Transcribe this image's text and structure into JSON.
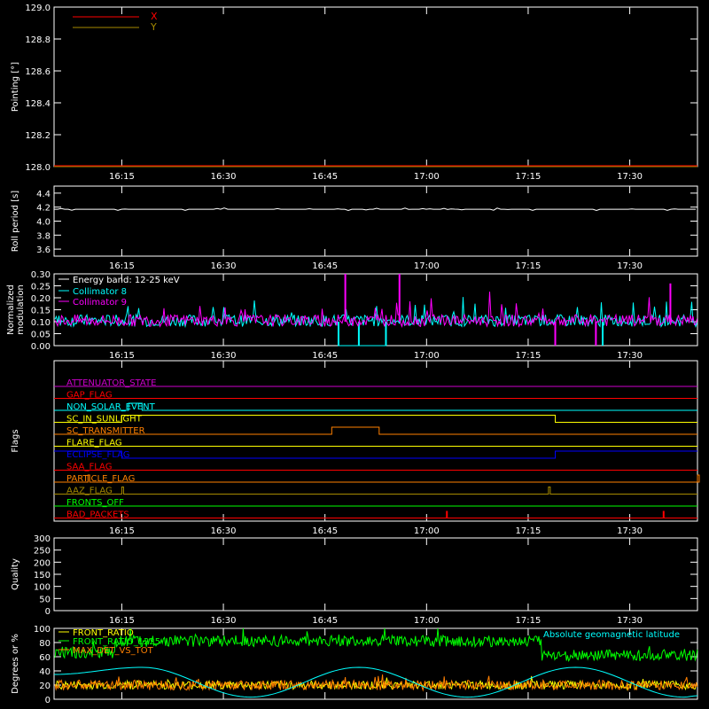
{
  "chart_data": [
    {
      "type": "line",
      "panel": "pointing",
      "ylabel": "Pointing [°]",
      "xlim": [
        "16:05",
        "17:40"
      ],
      "x_ticks": [
        "16:15",
        "16:30",
        "16:45",
        "17:00",
        "17:15",
        "17:30"
      ],
      "ylim": [
        128.0,
        129.0
      ],
      "y_ticks": [
        "128.0",
        "128.2",
        "128.4",
        "128.6",
        "128.8",
        "129.0"
      ],
      "legend": "top-left",
      "series": [
        {
          "name": "X",
          "color": "#ff0000",
          "x": [
            "16:05",
            "17:40"
          ],
          "y": [
            128.0,
            128.0
          ]
        },
        {
          "name": "Y",
          "color": "#a68a00",
          "x": [
            "16:05",
            "17:40"
          ],
          "y": [
            128.0,
            128.0
          ]
        }
      ]
    },
    {
      "type": "line",
      "panel": "roll",
      "ylabel": "Roll period [s]",
      "xlim": [
        "16:05",
        "17:40"
      ],
      "x_ticks": [
        "16:15",
        "16:30",
        "16:45",
        "17:00",
        "17:15",
        "17:30"
      ],
      "ylim": [
        3.5,
        4.5
      ],
      "y_ticks": [
        "3.6",
        "3.8",
        "4.0",
        "4.2",
        "4.4"
      ],
      "series": [
        {
          "color": "#ffffff",
          "x": [
            "16:05",
            "17:40"
          ],
          "y": [
            4.17,
            4.17
          ]
        }
      ]
    },
    {
      "type": "line",
      "panel": "modulation",
      "ylabel": [
        "Normalized",
        "modulation"
      ],
      "xlim": [
        "16:05",
        "17:40"
      ],
      "x_ticks": [
        "16:15",
        "16:30",
        "16:45",
        "17:00",
        "17:15",
        "17:30"
      ],
      "ylim": [
        0.0,
        0.3
      ],
      "y_ticks": [
        "0.00",
        "0.05",
        "0.10",
        "0.15",
        "0.20",
        "0.25",
        "0.30"
      ],
      "legend": "top-left",
      "legend_title": "Energy band: 12-25 keV",
      "series": [
        {
          "name": "Collimator 8",
          "color": "#00ffff",
          "baseline": 0.1,
          "spikes": [
            [
              "16:47",
              0.0
            ],
            [
              "16:50",
              0.0
            ],
            [
              "16:54",
              0.0
            ],
            [
              "17:26",
              0.0
            ]
          ]
        },
        {
          "name": "Collimator 9",
          "color": "#ff00ff",
          "baseline": 0.1,
          "spikes": [
            [
              "16:48",
              0.3
            ],
            [
              "16:56",
              0.3
            ],
            [
              "17:19",
              0.0
            ],
            [
              "17:25",
              0.0
            ],
            [
              "17:36",
              0.26
            ]
          ]
        }
      ]
    },
    {
      "type": "line",
      "panel": "flags",
      "ylabel": "Flags",
      "xlim": [
        "16:05",
        "17:40"
      ],
      "x_ticks": [
        "16:15",
        "16:30",
        "16:45",
        "17:00",
        "17:15",
        "17:30"
      ],
      "series": [
        {
          "name": "ATTENUATOR_STATE",
          "color": "#cc00cc",
          "steps": []
        },
        {
          "name": "GAP_FLAG",
          "color": "#ff0000",
          "steps": []
        },
        {
          "name": "NON_SOLAR_EVENT",
          "color": "#00ffff",
          "steps": [
            [
              "16:16",
              "16:18"
            ]
          ]
        },
        {
          "name": "SC_IN_SUNLIGHT",
          "color": "#ffff00",
          "steps": [
            [
              "16:15",
              "17:19"
            ]
          ]
        },
        {
          "name": "SC_TRANSMITTER",
          "color": "#ff8000",
          "steps": [
            [
              "16:46",
              "16:53"
            ]
          ]
        },
        {
          "name": "FLARE_FLAG",
          "color": "#ffff00",
          "steps": []
        },
        {
          "name": "ECLIPSE_FLAG",
          "color": "#0000ff",
          "steps": [
            [
              "16:05",
              "16:15"
            ],
            [
              "17:19",
              "17:40"
            ]
          ]
        },
        {
          "name": "SAA_FLAG",
          "color": "#ff0000",
          "steps": []
        },
        {
          "name": "PARTICLE_FLAG",
          "color": "#ff8000",
          "steps": [
            [
              "16:10",
              "16:10"
            ],
            [
              "17:40",
              "17:40"
            ]
          ]
        },
        {
          "name": "AAZ_FLAG",
          "color": "#a68a00",
          "steps": [
            [
              "16:15",
              "16:15"
            ],
            [
              "17:18",
              "17:18"
            ]
          ]
        },
        {
          "name": "FRONTS_OFF",
          "color": "#00ff00",
          "steps": []
        },
        {
          "name": "BAD_PACKETS",
          "color": "#ff0000",
          "spikes": [
            "17:03",
            "17:35"
          ]
        }
      ]
    },
    {
      "type": "line",
      "panel": "quality",
      "ylabel": "Quality",
      "xlim": [
        "16:05",
        "17:40"
      ],
      "x_ticks": [
        "16:15",
        "16:30",
        "16:45",
        "17:00",
        "17:15",
        "17:30"
      ],
      "ylim": [
        0,
        300
      ],
      "y_ticks": [
        "0",
        "50",
        "100",
        "150",
        "200",
        "250",
        "300"
      ],
      "series": []
    },
    {
      "type": "line",
      "panel": "ratio",
      "ylabel": "Degrees or %",
      "xlim": [
        "16:05",
        "17:40"
      ],
      "ylim": [
        0,
        100
      ],
      "y_ticks": [
        "0",
        "20",
        "40",
        "60",
        "80",
        "100"
      ],
      "legend": "top-left",
      "annotation": "Absolute geomagnetic latitude",
      "series": [
        {
          "name": "FRONT_RATIO",
          "color": "#ffff00",
          "approx": 20
        },
        {
          "name": "FRONT_RATIO_1225",
          "color": "#00ff00",
          "segments": [
            [
              "16:05",
              "16:14",
              66
            ],
            [
              "16:14",
              "17:17",
              82
            ],
            [
              "17:17",
              "17:40",
              62
            ]
          ]
        },
        {
          "name": "MAX_DET_VS_TOT",
          "color": "#ff8000",
          "approx": 20
        },
        {
          "name": "",
          "color": "#00ffff",
          "x": [
            "16:05",
            "16:18",
            "16:34",
            "16:50",
            "17:06",
            "17:22",
            "17:38",
            "17:40"
          ],
          "y": [
            35,
            45,
            3,
            45,
            3,
            45,
            3,
            5
          ]
        }
      ]
    }
  ]
}
